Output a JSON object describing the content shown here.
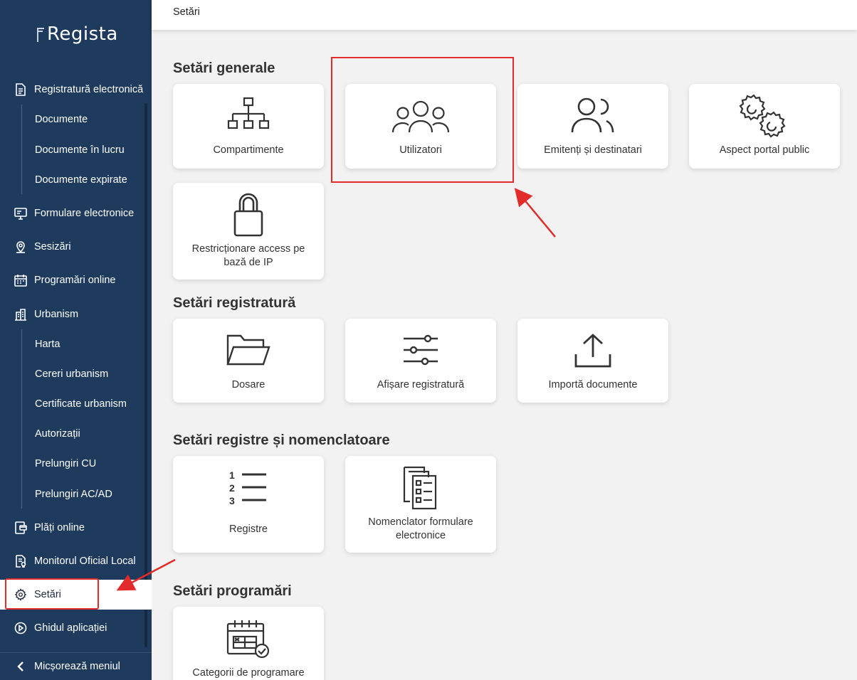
{
  "app": {
    "logo_text": "Regista"
  },
  "sidebar": {
    "items": [
      {
        "label": "Registratură electronică",
        "icon": "document-icon"
      },
      {
        "label": "Documente"
      },
      {
        "label": "Documente în lucru"
      },
      {
        "label": "Documente expirate"
      },
      {
        "label": "Formulare electronice",
        "icon": "monitor-form-icon"
      },
      {
        "label": "Sesizări",
        "icon": "map-pin-icon"
      },
      {
        "label": "Programări online",
        "icon": "calendar-icon"
      },
      {
        "label": "Urbanism",
        "icon": "building-icon"
      },
      {
        "label": "Harta"
      },
      {
        "label": "Cereri urbanism"
      },
      {
        "label": "Certificate urbanism"
      },
      {
        "label": "Autorizații"
      },
      {
        "label": "Prelungiri CU"
      },
      {
        "label": "Prelungiri AC/AD"
      },
      {
        "label": "Plăți online",
        "icon": "payment-icon"
      },
      {
        "label": "Monitorul Oficial Local",
        "icon": "certificate-icon"
      },
      {
        "label": "Setări",
        "icon": "gear-icon",
        "active": true
      },
      {
        "label": "Ghidul aplicației",
        "icon": "play-circle-icon"
      }
    ],
    "collapse_label": "Micșorează meniul"
  },
  "topbar": {
    "title": "Setări"
  },
  "sections": {
    "general": {
      "title": "Setări generale",
      "cards": [
        "Compartimente",
        "Utilizatori",
        "Emitenți și destinatari",
        "Aspect portal public",
        "Restricționare access pe bază de IP"
      ]
    },
    "registratura": {
      "title": "Setări registratură",
      "cards": [
        "Dosare",
        "Afișare registratură",
        "Importă documente"
      ]
    },
    "registre": {
      "title": "Setări registre și nomenclatoare",
      "cards": [
        "Registre",
        "Nomenclator formulare electronice"
      ]
    },
    "programari": {
      "title": "Setări programări",
      "cards": [
        "Categorii de programare"
      ]
    }
  },
  "colors": {
    "sidebar_bg": "#1e3a5c",
    "page_bg": "#f2f2f2",
    "highlight": "#e32b2b"
  }
}
